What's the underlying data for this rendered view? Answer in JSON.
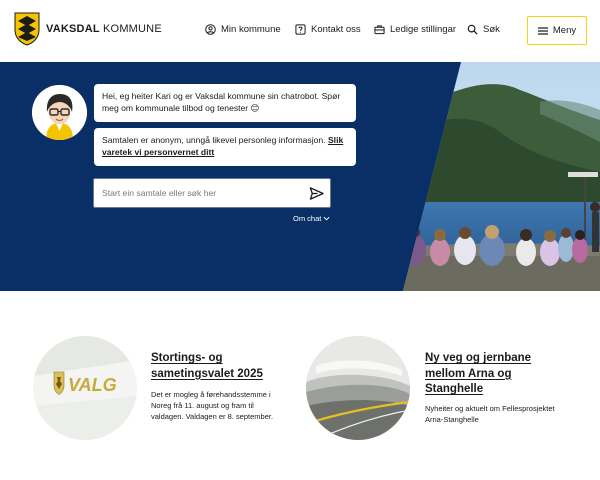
{
  "header": {
    "brand_bold": "VAKSDAL",
    "brand_rest": " KOMMUNE",
    "nav": {
      "min_kommune": "Min kommune",
      "kontakt": "Kontakt oss",
      "stillingar": "Ledige stillingar",
      "sok": "Søk"
    },
    "menu_label": "Meny"
  },
  "hero": {
    "bubble1": "Hei, eg heiter Kari og er Vaksdal kommune sin chatrobot. Spør meg om kommunale tilbod og tenester 😊",
    "bubble2_text": "Samtalen er anonym, unngå likevel personleg informasjon. ",
    "bubble2_link": "Slik varetek vi personvernet ditt",
    "input_placeholder": "Start ein samtale eller søk her",
    "om_chat": "Om chat"
  },
  "cards": [
    {
      "title": "Stortings- og sametingsvalet 2025",
      "text": "Det er mogleg å førehandsstemme i Noreg frå 11. august og fram til valdagen. Valdagen er 8. september.",
      "image_label": "VALG"
    },
    {
      "title": "Ny veg og jernbane mellom Arna og Stanghelle",
      "text": "Nyheiter og aktuelt om Fellesprosjektet Arna-Stanghelle"
    }
  ],
  "colors": {
    "hero_blue": "#0a2f66",
    "menu_border": "#f2d21b",
    "shield_yellow": "#f4c400"
  }
}
